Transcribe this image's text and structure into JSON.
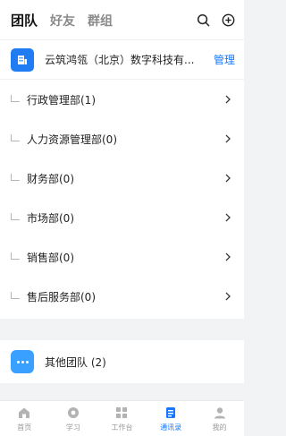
{
  "tabs": [
    {
      "label": "团队",
      "active": true
    },
    {
      "label": "好友",
      "active": false
    },
    {
      "label": "群组",
      "active": false
    }
  ],
  "top_actions": {
    "search_icon": "search-icon",
    "add_icon": "add-circle-icon"
  },
  "org": {
    "name": "云筑鸿瓴（北京）数字科技有...",
    "manage_label": "管理",
    "badge_color": "#1f7cf2"
  },
  "departments": [
    {
      "label": "行政管理部(1)"
    },
    {
      "label": "人力资源管理部(0)"
    },
    {
      "label": "财务部(0)"
    },
    {
      "label": "市场部(0)"
    },
    {
      "label": "销售部(0)"
    },
    {
      "label": "售后服务部(0)"
    }
  ],
  "other_teams": {
    "label": "其他团队 (2)",
    "badge_color": "#3aa0ff"
  },
  "bottom_nav": [
    {
      "label": "首页",
      "icon": "home-icon",
      "active": false
    },
    {
      "label": "学习",
      "icon": "learn-icon",
      "active": false
    },
    {
      "label": "工作台",
      "icon": "workbench-icon",
      "active": false
    },
    {
      "label": "通讯录",
      "icon": "contacts-icon",
      "active": true
    },
    {
      "label": "我的",
      "icon": "profile-icon",
      "active": false
    }
  ],
  "accent_color": "#1677ff"
}
